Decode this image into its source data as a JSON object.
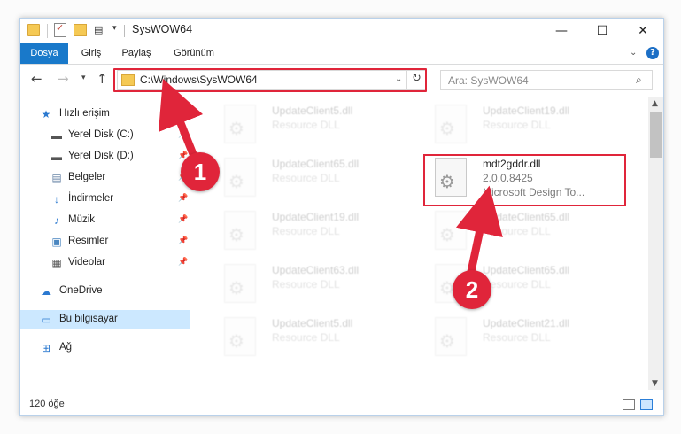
{
  "window": {
    "title": "SysWOW64",
    "controls": {
      "minimize": "—",
      "maximize": "☐",
      "close": "✕"
    }
  },
  "quick_access_toolbar": {
    "icons": [
      "folder-icon",
      "properties-icon",
      "new-folder-icon",
      "view-icon",
      "customize-dropdown-icon"
    ]
  },
  "ribbon": {
    "tabs": [
      "Dosya",
      "Giriş",
      "Paylaş",
      "Görünüm"
    ],
    "active_tab": "Dosya",
    "active_color": "#1979ca"
  },
  "navigation": {
    "address": "C:\\Windows\\SysWOW64",
    "search_placeholder": "Ara: SysWOW64"
  },
  "sidebar": {
    "items": [
      {
        "label": "Hızlı erişim",
        "icon": "star-icon",
        "pinned": false
      },
      {
        "label": "Yerel Disk (C:)",
        "icon": "drive-icon",
        "pinned": true
      },
      {
        "label": "Yerel Disk (D:)",
        "icon": "drive-icon",
        "pinned": true
      },
      {
        "label": "Belgeler",
        "icon": "documents-icon",
        "pinned": true
      },
      {
        "label": "İndirmeler",
        "icon": "download-icon",
        "pinned": true
      },
      {
        "label": "Müzik",
        "icon": "music-icon",
        "pinned": true
      },
      {
        "label": "Resimler",
        "icon": "pictures-icon",
        "pinned": true
      },
      {
        "label": "Videolar",
        "icon": "videos-icon",
        "pinned": true
      },
      {
        "label": "OneDrive",
        "icon": "cloud-icon",
        "pinned": false
      },
      {
        "label": "Bu bilgisayar",
        "icon": "computer-icon",
        "pinned": false,
        "selected": true
      },
      {
        "label": "Ağ",
        "icon": "network-icon",
        "pinned": false
      }
    ]
  },
  "files": [
    {
      "name": "UpdateClient5.dll",
      "desc": "Resource DLL",
      "faded": true
    },
    {
      "name": "UpdateClient19.dll",
      "desc": "Resource DLL",
      "faded": true
    },
    {
      "name": "UpdateClient65.dll",
      "desc": "Resource DLL",
      "faded": true
    },
    {
      "name": "mdt2gddr.dll",
      "desc": "2.0.0.8425",
      "extra": "Microsoft Design To...",
      "faded": false
    },
    {
      "name": "UpdateClient19.dll",
      "desc": "Resource DLL",
      "faded": true
    },
    {
      "name": "UpdateClient65.dll",
      "desc": "Resource DLL",
      "faded": true
    },
    {
      "name": "UpdateClient63.dll",
      "desc": "Resource DLL",
      "faded": true
    },
    {
      "name": "UpdateClient65.dll",
      "desc": "Resource DLL",
      "faded": true
    },
    {
      "name": "UpdateClient5.dll",
      "desc": "Resource DLL",
      "faded": true
    },
    {
      "name": "UpdateClient21.dll",
      "desc": "Resource DLL",
      "faded": true
    }
  ],
  "status": {
    "item_count": "120 öğe"
  },
  "annotations": {
    "step1": "1",
    "step2": "2",
    "color": "#e0253a"
  }
}
